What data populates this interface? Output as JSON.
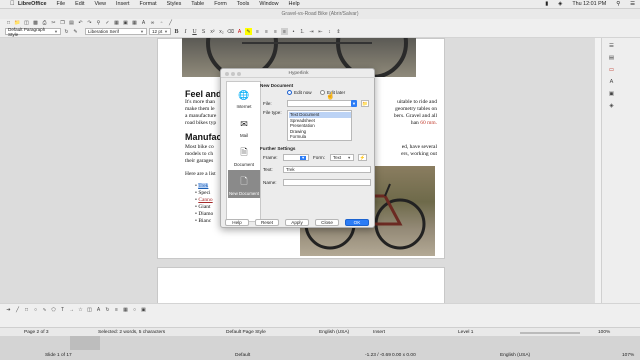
{
  "menubar": {
    "apple": "",
    "app": "LibreOffice",
    "items": [
      "File",
      "Edit",
      "View",
      "Insert",
      "Format",
      "Styles",
      "Table",
      "Form",
      "Tools",
      "Window",
      "Help"
    ],
    "clock": "Thu 12:01 PM"
  },
  "window": {
    "title": "Gravel-vs-Road Bike (Abrir/Salvar)"
  },
  "toolbar": {
    "para_style": "Default Paragraph Style",
    "font_name": "Liberation Serif",
    "font_size": "12 pt"
  },
  "document": {
    "heading1": "Feel and",
    "para1": [
      "It's more than",
      "make them le",
      "a manufacture",
      "road bikes typ"
    ],
    "para1_right": [
      "uitable to ride and",
      "geometry tables on",
      "bers. Gravel and all",
      "han"
    ],
    "para1_link": "60 mm.",
    "heading2": "Manufac",
    "para2": [
      "Most bike co",
      "models to ch",
      "their garages"
    ],
    "para2_right": [
      "ed, have several",
      "ers, working out"
    ],
    "list_intro": "Here are a list",
    "list_items": [
      "Trek",
      "Speci",
      "Canno",
      "Giant",
      "Diamo",
      "Bianc"
    ]
  },
  "dialog": {
    "title": "Hyperlink",
    "categories": [
      {
        "label": "Internet",
        "icon": "globe-icon"
      },
      {
        "label": "Mail",
        "icon": "mail-icon"
      },
      {
        "label": "Document",
        "icon": "document-icon"
      },
      {
        "label": "New Document",
        "icon": "new-document-icon"
      }
    ],
    "selected_category": "New Document",
    "section_new": "New Document",
    "edit_now": "Edit now",
    "edit_later": "Edit later",
    "file_label": "File:",
    "file_value": "",
    "filetype_label": "File type:",
    "file_types": [
      "Text Document",
      "Spreadsheet",
      "Presentation",
      "Drawing",
      "Formula"
    ],
    "selected_type": "Text Document",
    "section_further": "Further Settings",
    "frame_label": "Frame:",
    "form_label": "Form:",
    "form_value": "Text",
    "text_label": "Text:",
    "text_value": "Trek",
    "name_label": "Name:",
    "name_value": "",
    "buttons": {
      "help": "Help",
      "reset": "Reset",
      "apply": "Apply",
      "close": "Close",
      "ok": "OK"
    }
  },
  "status": {
    "page": "Page 2 of 3",
    "words": "Selected: 2 words, 5 characters",
    "style": "Default Page Style",
    "lang": "English (USA)",
    "mode": "Insert",
    "level": "Level 1",
    "zoom": "100%"
  },
  "bottom": {
    "slide": "Slide 1 of 17",
    "layout": "Default",
    "lang": "English (USA)",
    "coords": "-1.23 / -0.69",
    "size": "0.00 x 0.00",
    "zoom": "107%"
  },
  "colors": {
    "accent": "#2b7cf6",
    "link": "#1a5fb4",
    "selection": "#bcd3f5"
  }
}
